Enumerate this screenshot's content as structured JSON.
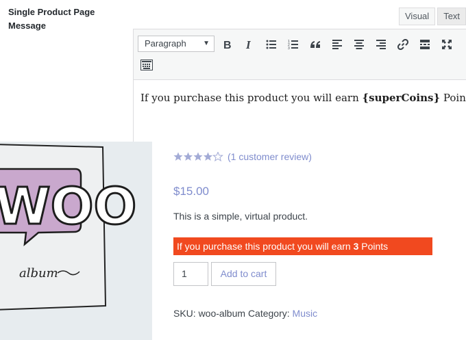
{
  "settings": {
    "field_label": "Single Product Page Message"
  },
  "editor": {
    "tab_visual": "Visual",
    "tab_text": "Text",
    "format_select": "Paragraph",
    "content_prefix": "If you purchase this product you will earn ",
    "content_token": "{superCoins}",
    "content_suffix": " Points",
    "toolbar_icons": [
      "bold-icon",
      "italic-icon",
      "bulleted-list-icon",
      "numbered-list-icon",
      "blockquote-icon",
      "align-left-icon",
      "align-center-icon",
      "align-right-icon",
      "link-icon",
      "read-more-icon",
      "fullscreen-icon",
      "toolbar-toggle-icon"
    ]
  },
  "product": {
    "image_text": "WOO album",
    "image_word_big": "WOO",
    "image_word_small": "album",
    "rating": 4,
    "rating_max": 5,
    "review_link": "(1 customer review)",
    "price": "$15.00",
    "description": "This is a simple, virtual product.",
    "earn_prefix": "If you purchase this product you will earn ",
    "earn_amount": "3",
    "earn_suffix": " Points",
    "quantity": "1",
    "add_to_cart": "Add to cart",
    "sku_label": "SKU: woo-album",
    "category_label": "Category:",
    "category_value": "Music"
  },
  "colors": {
    "accent_link": "#7f8ccd",
    "notice_bg": "#f1491f",
    "star_fill": "#a3abd6",
    "image_bg": "#e7ecef",
    "bubble": "#c9a8cd"
  }
}
